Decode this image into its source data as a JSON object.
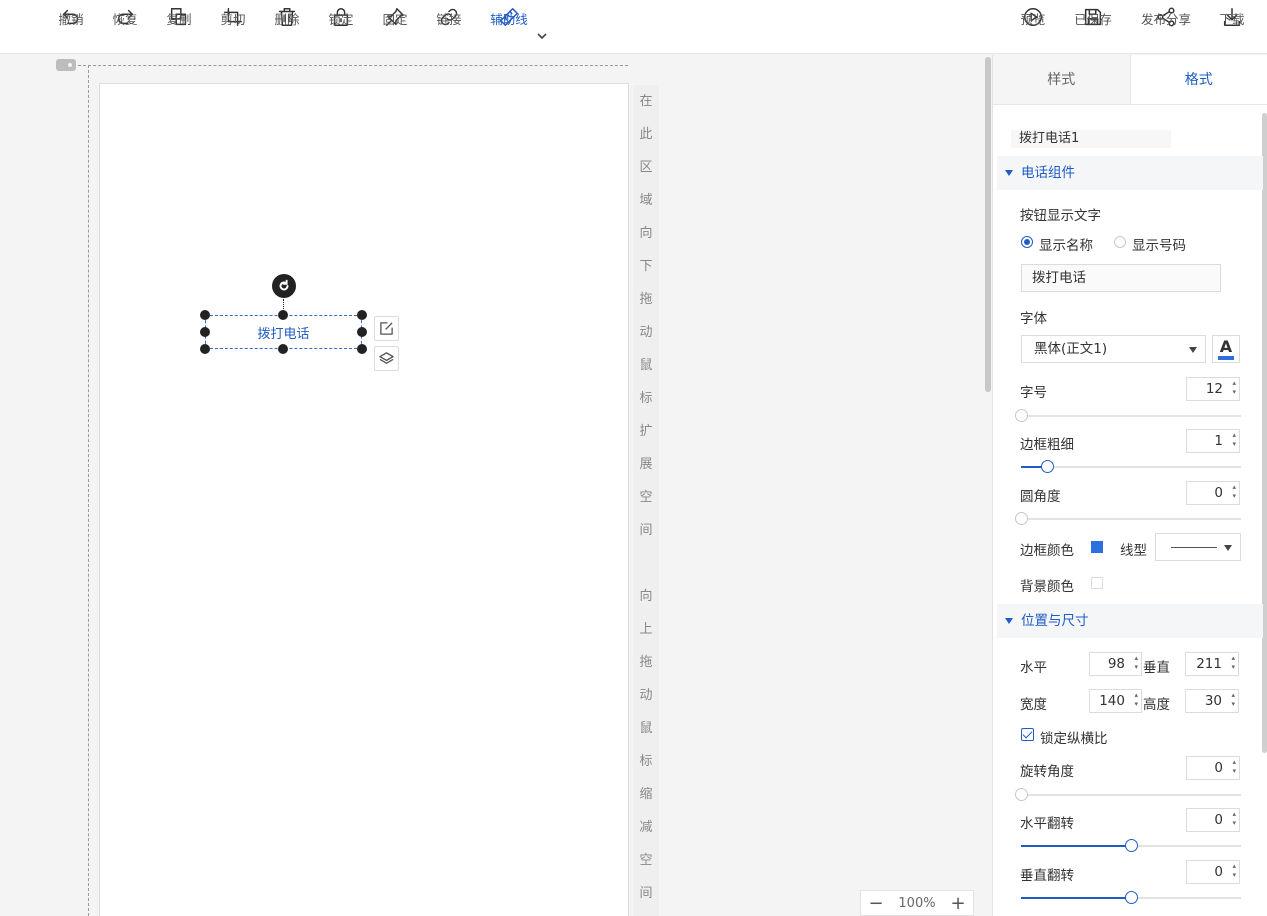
{
  "toolbar": {
    "undo": "撤销",
    "redo": "恢复",
    "copy": "复制",
    "cut": "剪切",
    "delete": "删除",
    "lock": "锁定",
    "pin": "固定",
    "link": "链接",
    "guides": "辅助线",
    "preview": "预览",
    "saved": "已保存",
    "publish": "发布分享",
    "download": "下载"
  },
  "canvas": {
    "hint_down": [
      "在",
      "此",
      "区",
      "域",
      "向",
      "下",
      "拖",
      "动",
      "鼠",
      "标",
      "扩",
      "展",
      "空",
      "间"
    ],
    "hint_up": [
      "向",
      "上",
      "拖",
      "动",
      "鼠",
      "标",
      "缩",
      "减",
      "空",
      "间"
    ],
    "widget_label": "拨打电话",
    "zoom": "100%",
    "zoom_minus": "−",
    "zoom_plus": "+"
  },
  "panel": {
    "tabs": [
      "样式",
      "格式"
    ],
    "active_tab": "格式",
    "component_name": "拨打电话1",
    "phone_section": {
      "title": "电话组件",
      "button_text_label": "按钮显示文字",
      "radio_show_name": "显示名称",
      "radio_show_number": "显示号码",
      "radio_selected": "显示名称",
      "button_text_value": "拨打电话",
      "font_label": "字体",
      "font_value": "黑体(正文1)",
      "font_color_glyph": "A",
      "font_size_label": "字号",
      "font_size": "12",
      "font_size_slider": 0.0,
      "border_width_label": "边框粗细",
      "border_width": "1",
      "border_width_slider": 0.12,
      "radius_label": "圆角度",
      "radius": "0",
      "radius_slider": 0.0,
      "border_color_label": "边框颜色",
      "border_color": "#2b6fe0",
      "line_type_label": "线型",
      "bg_color_label": "背景颜色",
      "bg_color": "#ffffff"
    },
    "position_section": {
      "title": "位置与尺寸",
      "x_label": "水平",
      "x": "98",
      "y_label": "垂直",
      "y": "211",
      "w_label": "宽度",
      "w": "140",
      "h_label": "高度",
      "h": "30",
      "lock_ratio_label": "锁定纵横比",
      "lock_ratio": true,
      "rotate_label": "旋转角度",
      "rotate": "0",
      "rotate_slider": 0.0,
      "flip_h_label": "水平翻转",
      "flip_h": "0",
      "flip_h_slider": 0.5,
      "flip_v_label": "垂直翻转",
      "flip_v": "0",
      "flip_v_slider": 0.5
    }
  },
  "colors": {
    "accent": "#1f5cc4"
  }
}
